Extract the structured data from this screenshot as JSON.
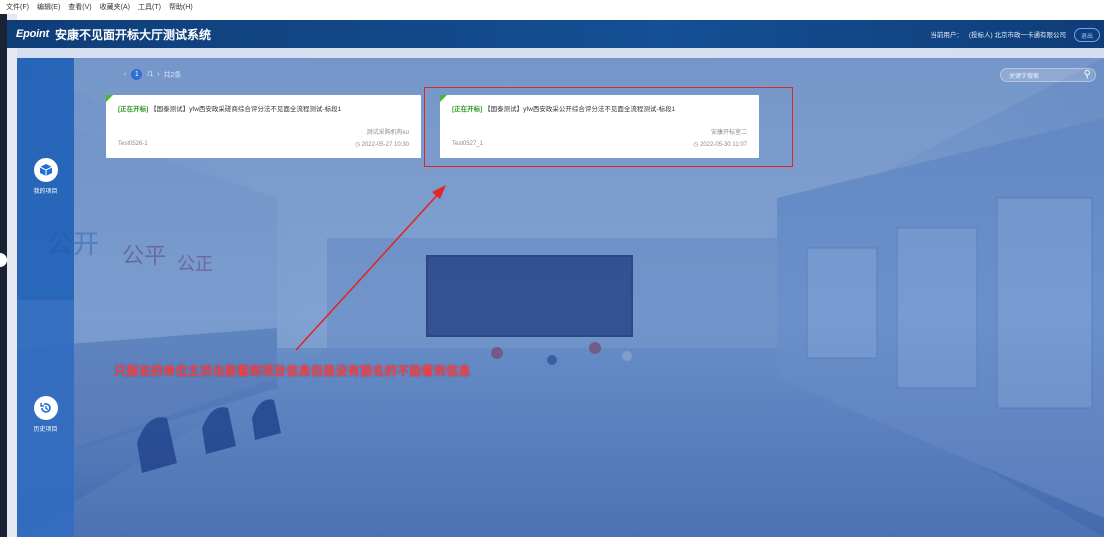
{
  "menubar": [
    "文件(F)",
    "编辑(E)",
    "查看(V)",
    "收藏夹(A)",
    "工具(T)",
    "帮助(H)"
  ],
  "header": {
    "logo": "Epoint",
    "title": "安康不见面开标大厅测试系统",
    "user_label": "当前用户：",
    "user_name": "(投标人) 北京市政一卡通有限公司",
    "exit_label": "退出"
  },
  "pager": {
    "prev": "‹",
    "current": "1",
    "total": "/1",
    "next": "›",
    "count": "共2条"
  },
  "search": {
    "placeholder": "关键字搜索"
  },
  "nav": {
    "current_projects": "我的项目",
    "history_projects": "历史项目"
  },
  "cards": [
    {
      "status": "[正在开标]",
      "title": "【国泰测试】yfw西安政采磋商综合评分法不见面全流程测试-标段1",
      "agent": "测试采购机构xu",
      "code": "Test0526-1",
      "time": "2022-05-27 10:30"
    },
    {
      "status": "[正在开标]",
      "title": "【国泰测试】yfw西安政采公开综合评分法不见面全流程测试-标段1",
      "agent": "安康开标室二",
      "code": "Test0527_1",
      "time": "2022-05-30 11:07"
    }
  ],
  "annotation": "只报名的单位主页也能看到项目信息但是没有报名的不能看到信息",
  "colors": {
    "header": "#154f95",
    "accent": "#2f6fd2",
    "status": "#2f9a24",
    "annotation": "#ff3b3b"
  }
}
